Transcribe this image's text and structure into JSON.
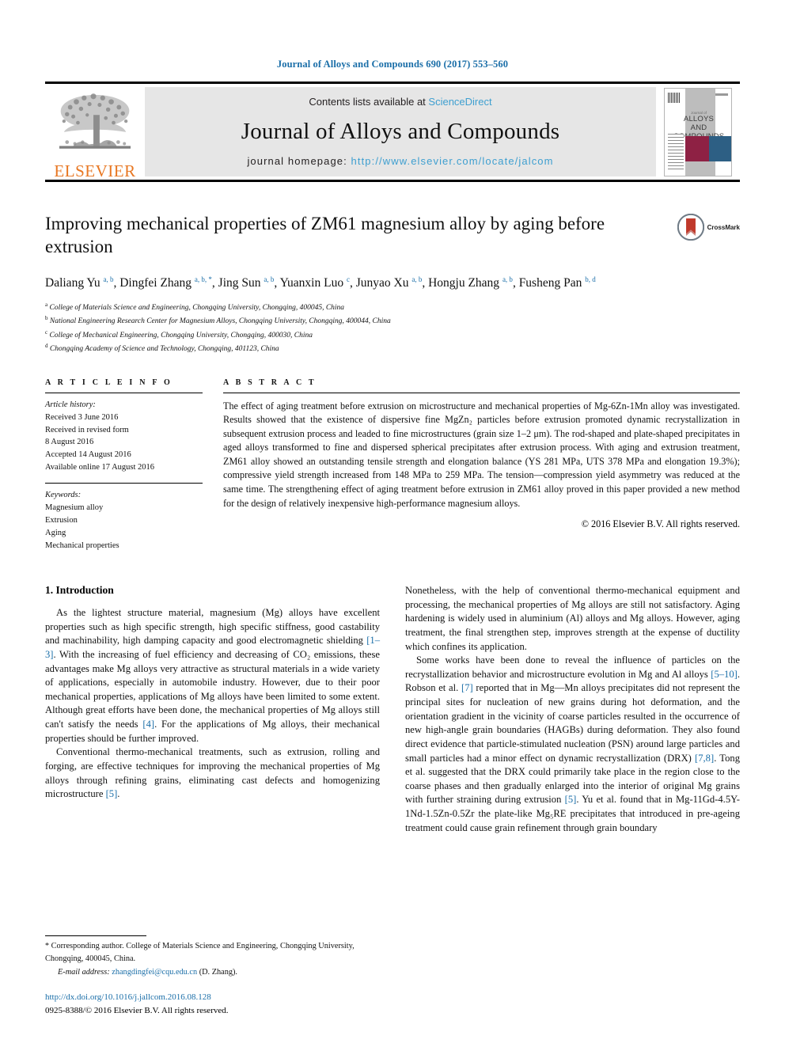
{
  "running_head": "Journal of Alloys and Compounds 690 (2017) 553–560",
  "masthead": {
    "publisher": "ELSEVIER",
    "contents_prefix": "Contents lists available at ",
    "contents_link": "ScienceDirect",
    "journal_title": "Journal of Alloys and Compounds",
    "homepage_prefix": "journal homepage: ",
    "homepage_url": "http://www.elsevier.com/locate/jalcom",
    "cover": {
      "line1": "Journal of",
      "line2": "ALLOYS",
      "line3": "AND COMPOUNDS",
      "sub": "An Interdisciplinary Journal of Materials Science and Solid-state Chemistry and Physics"
    }
  },
  "crossmark": {
    "label": "CrossMark"
  },
  "article": {
    "title": "Improving mechanical properties of ZM61 magnesium alloy by aging before extrusion",
    "authors": [
      {
        "name": "Daliang Yu",
        "sup": "a, b",
        "sep": ", "
      },
      {
        "name": "Dingfei Zhang",
        "sup": "a, b, *",
        "sep": ", "
      },
      {
        "name": "Jing Sun",
        "sup": "a, b",
        "sep": ", "
      },
      {
        "name": "Yuanxin Luo",
        "sup": "c",
        "sep": ", "
      },
      {
        "name": "Junyao Xu",
        "sup": "a, b",
        "sep": ", "
      },
      {
        "name": "Hongju Zhang",
        "sup": "a, b",
        "sep": ", "
      },
      {
        "name": "Fusheng Pan",
        "sup": "b, d",
        "sep": ""
      }
    ],
    "affiliations": [
      {
        "mark": "a",
        "text": "College of Materials Science and Engineering, Chongqing University, Chongqing, 400045, China"
      },
      {
        "mark": "b",
        "text": "National Engineering Research Center for Magnesium Alloys, Chongqing University, Chongqing, 400044, China"
      },
      {
        "mark": "c",
        "text": "College of Mechanical Engineering, Chongqing University, Chongqing, 400030, China"
      },
      {
        "mark": "d",
        "text": "Chongqing Academy of Science and Technology, Chongqing, 401123, China"
      }
    ]
  },
  "article_info": {
    "heading": "A R T I C L E  I N F O",
    "history_label": "Article history:",
    "history": [
      "Received 3 June 2016",
      "Received in revised form",
      "8 August 2016",
      "Accepted 14 August 2016",
      "Available online 17 August 2016"
    ],
    "keywords_label": "Keywords:",
    "keywords": [
      "Magnesium alloy",
      "Extrusion",
      "Aging",
      "Mechanical properties"
    ]
  },
  "abstract": {
    "heading": "A B S T R A C T",
    "text": "The effect of aging treatment before extrusion on microstructure and mechanical properties of Mg-6Zn-1Mn alloy was investigated. Results showed that the existence of dispersive fine MgZn₂ particles before extrusion promoted dynamic recrystallization in subsequent extrusion process and leaded to fine microstructures (grain size 1–2 μm). The rod-shaped and plate-shaped precipitates in aged alloys transformed to fine and dispersed spherical precipitates after extrusion process. With aging and extrusion treatment, ZM61 alloy showed an outstanding tensile strength and elongation balance (YS 281 MPa, UTS 378 MPa and elongation 19.3%); compressive yield strength increased from 148 MPa to 259 MPa. The tension—compression yield asymmetry was reduced at the same time. The strengthening effect of aging treatment before extrusion in ZM61 alloy proved in this paper provided a new method for the design of relatively inexpensive high-performance magnesium alloys.",
    "copyright": "© 2016 Elsevier B.V. All rights reserved."
  },
  "body": {
    "section_heading": "1.  Introduction",
    "left_paragraphs": [
      "As the lightest structure material, magnesium (Mg) alloys have excellent properties such as high specific strength, high specific stiffness, good castability and machinability, high damping capacity and good electromagnetic shielding [1–3]. With the increasing of fuel efficiency and decreasing of CO₂ emissions, these advantages make Mg alloys very attractive as structural materials in a wide variety of applications, especially in automobile industry. However, due to their poor mechanical properties, applications of Mg alloys have been limited to some extent. Although great efforts have been done, the mechanical properties of Mg alloys still can't satisfy the needs [4]. For the applications of Mg alloys, their mechanical properties should be further improved.",
      "Conventional thermo-mechanical treatments, such as extrusion, rolling and forging, are effective techniques for improving the mechanical properties of Mg alloys through refining grains, eliminating cast defects and homogenizing microstructure [5]."
    ],
    "right_paragraphs": [
      "Nonetheless, with the help of conventional thermo-mechanical equipment and processing, the mechanical properties of Mg alloys are still not satisfactory. Aging hardening is widely used in aluminium (Al) alloys and Mg alloys. However, aging treatment, the final strengthen step, improves strength at the expense of ductility which confines its application.",
      "Some works have been done to reveal the influence of particles on the recrystallization behavior and microstructure evolution in Mg and Al alloys [5–10]. Robson et al. [7] reported that in Mg—Mn alloys precipitates did not represent the principal sites for nucleation of new grains during hot deformation, and the orientation gradient in the vicinity of coarse particles resulted in the occurrence of new high-angle grain boundaries (HAGBs) during deformation. They also found direct evidence that particle-stimulated nucleation (PSN) around large particles and small particles had a minor effect on dynamic recrystallization (DRX) [7,8]. Tong et al. suggested that the DRX could primarily take place in the region close to the coarse phases and then gradually enlarged into the interior of original Mg grains with further straining during extrusion [5]. Yu et al. found that in Mg-11Gd-4.5Y-1Nd-1.5Zn-0.5Zr the plate-like Mg₅RE precipitates that introduced in pre-ageing treatment could cause grain refinement through grain boundary"
    ]
  },
  "footer": {
    "corresponding_mark": "*",
    "corresponding_text": "Corresponding author. College of Materials Science and Engineering, Chongqing University, Chongqing, 400045, China.",
    "email_label": "E-mail address:",
    "email": "zhangdingfei@cqu.edu.cn",
    "email_suffix": "(D. Zhang).",
    "doi": "http://dx.doi.org/10.1016/j.jallcom.2016.08.128",
    "issn_line": "0925-8388/© 2016 Elsevier B.V. All rights reserved."
  },
  "colors": {
    "link": "#1a6ea8",
    "sciencedirect": "#3e9fd0",
    "elsevier_orange": "#E87722",
    "cover_red": "#8e2144",
    "cover_blue": "#2d5f84"
  }
}
